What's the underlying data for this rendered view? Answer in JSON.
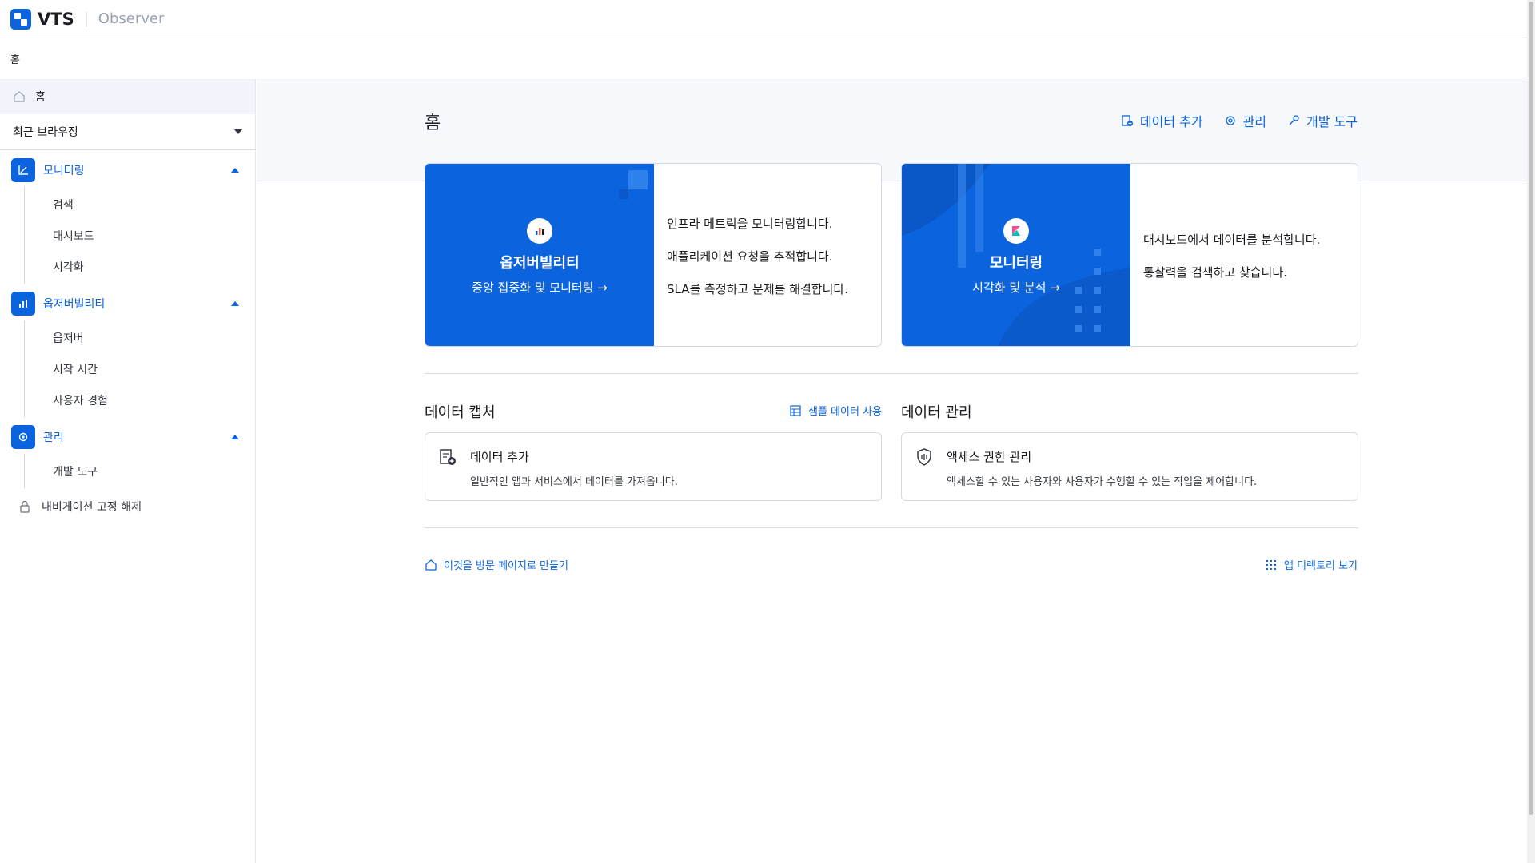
{
  "header": {
    "brand": "VTS",
    "product": "Observer"
  },
  "breadcrumb": {
    "current": "홈"
  },
  "sidebar": {
    "home_label": "홈",
    "recent_label": "최근 브라우징",
    "groups": [
      {
        "label": "모니터링",
        "items": [
          "검색",
          "대시보드",
          "시각화"
        ]
      },
      {
        "label": "옵저버빌리티",
        "items": [
          "옵저버",
          "시작 시간",
          "사용자 경험"
        ]
      },
      {
        "label": "관리",
        "items": [
          "개발 도구"
        ]
      }
    ],
    "unpin_label": "내비게이션 고정 해제"
  },
  "main": {
    "title": "홈",
    "actions": {
      "add_data": "데이터 추가",
      "manage": "관리",
      "dev_tools": "개발 도구"
    },
    "cards": [
      {
        "title": "옵저버빌리티",
        "link": "중앙 집중화 및 모니터링 →",
        "lines": [
          "인프라 메트릭을 모니터링합니다.",
          "애플리케이션 요청을 추적합니다.",
          "SLA를 측정하고 문제를 해결합니다."
        ]
      },
      {
        "title": "모니터링",
        "link": "시각화 및 분석 →",
        "lines": [
          "대시보드에서 데이터를 분석합니다.",
          "통찰력을 검색하고 찾습니다."
        ]
      }
    ],
    "data_capture": {
      "title": "데이터 캡처",
      "sample_link": "샘플 데이터 사용",
      "panel_title": "데이터 추가",
      "panel_desc": "일반적인 앱과 서비스에서 데이터를 가져옵니다."
    },
    "data_management": {
      "title": "데이터 관리",
      "panel_title": "액세스 권한 관리",
      "panel_desc": "액세스할 수 있는 사용자와 사용자가 수행할 수 있는 작업을 제어합니다."
    },
    "footer": {
      "landing_link": "이것을 방문 페이지로 만들기",
      "directory_link": "앱 디렉토리 보기"
    }
  },
  "colors": {
    "accent": "#0b64dd",
    "border": "#d3dae6",
    "band": "#f7f8fc"
  }
}
